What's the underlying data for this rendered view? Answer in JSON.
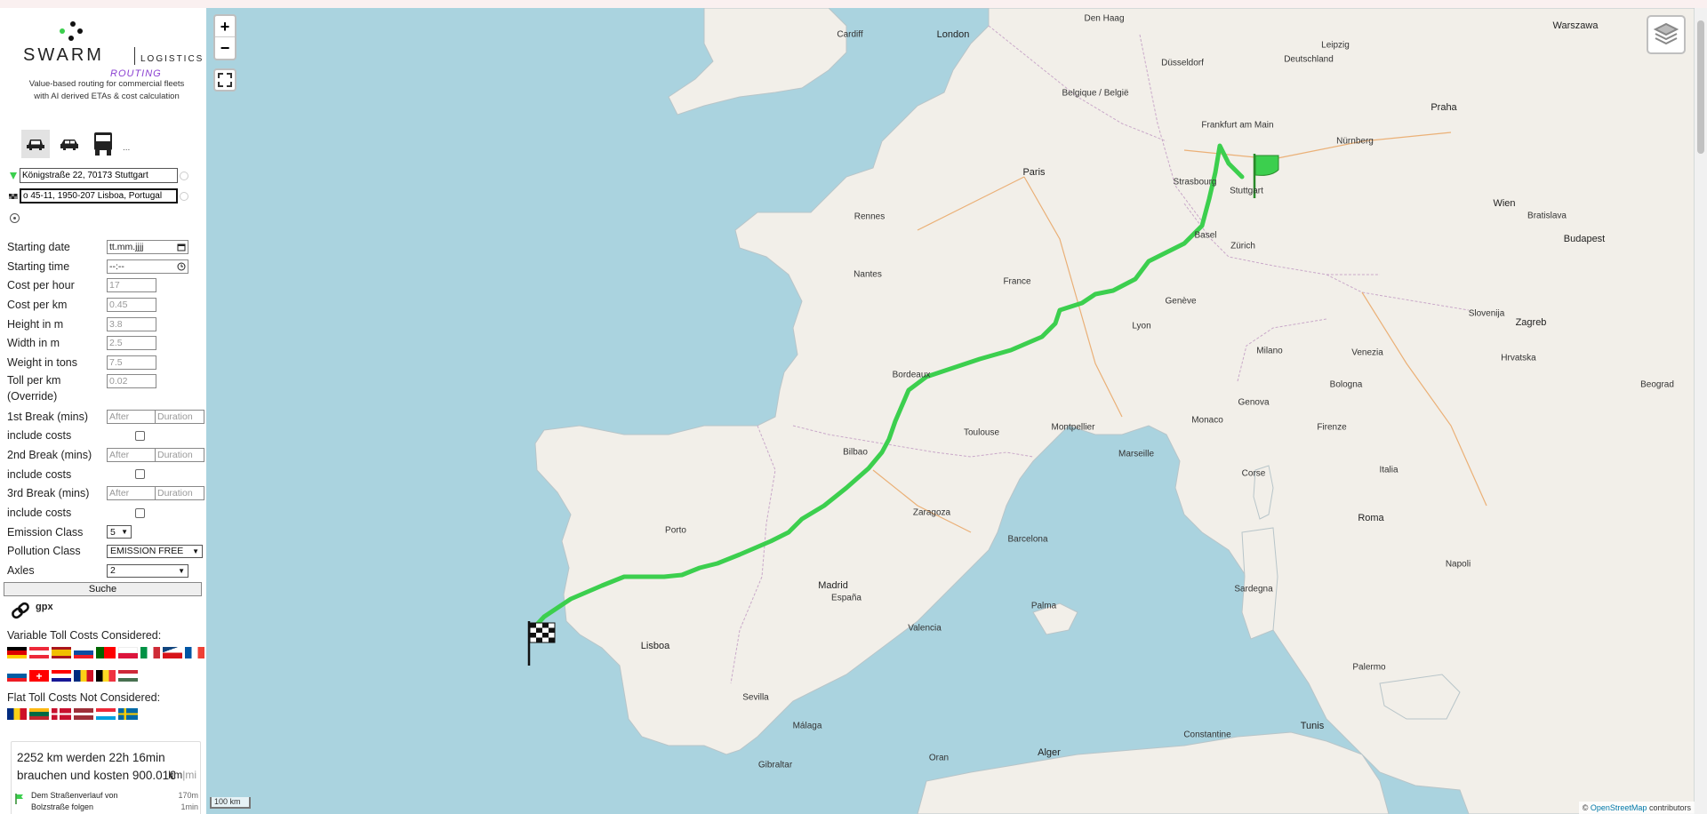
{
  "brand": {
    "swarm": "SWARM",
    "logistics": "LOGISTICS",
    "routing": "ROUTING",
    "tagline_line1": "Value-based routing for commercial fleets",
    "tagline_line2": "with AI derived ETAs & cost calculation"
  },
  "vehicles": {
    "more": "..."
  },
  "route_inputs": {
    "origin": "Königstraße 22, 70173 Stuttgart",
    "destination": "o 45-11, 1950-207 Lisboa, Portugal"
  },
  "form": {
    "starting_date": {
      "label": "Starting date",
      "placeholder": "tt.mm.jjjj"
    },
    "starting_time": {
      "label": "Starting time",
      "placeholder": "--:--"
    },
    "cost_per_hour": {
      "label": "Cost per hour",
      "value": "17"
    },
    "cost_per_km": {
      "label": "Cost per km",
      "value": "0.45"
    },
    "height": {
      "label": "Height in m",
      "value": "3.8"
    },
    "width": {
      "label": "Width in m",
      "value": "2.5"
    },
    "weight": {
      "label": "Weight in tons",
      "value": "7.5"
    },
    "toll_per_km": {
      "label_line1": "Toll per km",
      "label_line2": "(Override)",
      "value": "0.02"
    },
    "break1": {
      "label": "1st Break (mins)",
      "after": "After",
      "duration": "Duration"
    },
    "break2": {
      "label": "2nd Break (mins)",
      "after": "After",
      "duration": "Duration"
    },
    "break3": {
      "label": "3rd Break (mins)",
      "after": "After",
      "duration": "Duration"
    },
    "include_costs": "include costs",
    "emission_class": {
      "label": "Emission Class",
      "value": "5"
    },
    "pollution_class": {
      "label": "Pollution Class",
      "value": "EMISSION FREE"
    },
    "axles": {
      "label": "Axles",
      "value": "2"
    },
    "submit": "Suche"
  },
  "gpx_label": "gpx",
  "tolls": {
    "variable_title": "Variable Toll Costs Considered:",
    "flat_title": "Flat Toll Costs Not Considered:"
  },
  "result": {
    "summary": "2252 km werden 22h 16min brauchen und kosten 900.01€",
    "unit_km": "km",
    "unit_sep": "|",
    "unit_mi": "mi",
    "step_text": "Dem Straßenverlauf von Bolzstraße folgen",
    "step_distance": "170m",
    "step_time": "1min"
  },
  "map": {
    "zoom_in": "+",
    "zoom_out": "−",
    "scale": "100 km",
    "attribution_prefix": "©",
    "attribution_link": "OpenStreetMap",
    "attribution_suffix": "contributors",
    "colors": {
      "route": "#3ccf4e",
      "water": "#aad3df",
      "land": "#f2efe9"
    },
    "cities": [
      {
        "name": "Warszawa",
        "cap": true
      },
      {
        "name": "London",
        "cap": true
      },
      {
        "name": "Den Haag"
      },
      {
        "name": "Düsseldorf"
      },
      {
        "name": "Deutschland"
      },
      {
        "name": "Leipzig"
      },
      {
        "name": "Frankfurt am Main"
      },
      {
        "name": "Nürnberg"
      },
      {
        "name": "Praha",
        "cap": true
      },
      {
        "name": "Paris",
        "cap": true
      },
      {
        "name": "Rennes"
      },
      {
        "name": "Nantes"
      },
      {
        "name": "France"
      },
      {
        "name": "Bordeaux"
      },
      {
        "name": "Toulouse"
      },
      {
        "name": "Montpellier"
      },
      {
        "name": "Marseille"
      },
      {
        "name": "Lyon"
      },
      {
        "name": "Genève"
      },
      {
        "name": "Zürich"
      },
      {
        "name": "Basel"
      },
      {
        "name": "Milano"
      },
      {
        "name": "Venezia"
      },
      {
        "name": "Bologna"
      },
      {
        "name": "Firenze"
      },
      {
        "name": "Roma",
        "cap": true
      },
      {
        "name": "Napoli"
      },
      {
        "name": "Italia"
      },
      {
        "name": "Wien",
        "cap": true
      },
      {
        "name": "Budapest",
        "cap": true
      },
      {
        "name": "Zagreb",
        "cap": true
      },
      {
        "name": "Hrvatska"
      },
      {
        "name": "Madrid",
        "cap": true
      },
      {
        "name": "España"
      },
      {
        "name": "Barcelona"
      },
      {
        "name": "Valencia"
      },
      {
        "name": "Zaragoza"
      },
      {
        "name": "Sevilla"
      },
      {
        "name": "Málaga"
      },
      {
        "name": "Lisboa",
        "cap": true
      },
      {
        "name": "Porto"
      },
      {
        "name": "Bilbao"
      },
      {
        "name": "Palma"
      },
      {
        "name": "Alger",
        "cap": true
      },
      {
        "name": "Tunis",
        "cap": true
      },
      {
        "name": "Palermo"
      },
      {
        "name": "Sardegna"
      },
      {
        "name": "Corse"
      },
      {
        "name": "Monaco"
      },
      {
        "name": "Genova"
      },
      {
        "name": "Strasbourg"
      },
      {
        "name": "Stuttgart"
      },
      {
        "name": "Cardiff"
      },
      {
        "name": "Belgique / België"
      },
      {
        "name": "Bratislava"
      },
      {
        "name": "Slovenija"
      },
      {
        "name": "Beograd"
      },
      {
        "name": "Gibraltar"
      },
      {
        "name": "Oran"
      },
      {
        "name": "Constantine"
      }
    ]
  }
}
